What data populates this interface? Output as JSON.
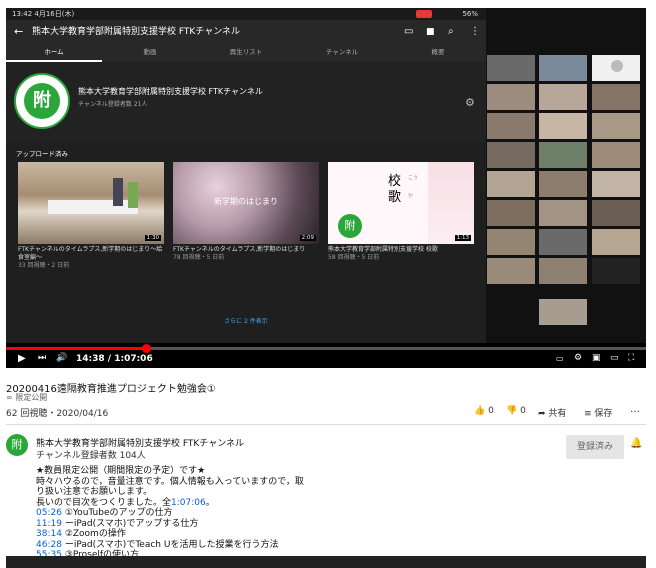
{
  "phone": {
    "status_time": "13:42 4月16日(木)",
    "status_right": "56%",
    "app_title": "熊本大学教育学部附属特別支援学校 FTKチャンネル",
    "tabs": [
      "ホーム",
      "動画",
      "再生リスト",
      "チャンネル",
      "概要"
    ],
    "channel_name": "熊本大学教育学部附属特別支援学校 FTKチャンネル",
    "channel_subs": "チャンネル登録者数 21人",
    "logo_char": "附",
    "uploads_title": "アップロード済み",
    "videos": [
      {
        "title": "FTKチャンネルのタイムラプス,新学期のはじまり〜給食室編〜",
        "views": "33 回視聴・2 日前",
        "duration": "1:30",
        "thumb_text": ""
      },
      {
        "title": "FTKチャンネルのタイムラプス,新学期のはじまり",
        "views": "78 回視聴・5 日前",
        "duration": "2:09",
        "thumb_text": "新学期のはじまり"
      },
      {
        "title": "熊本大学教育学部附属特別支援学校 校歌",
        "views": "58 回視聴・5 日前",
        "duration": "1:13",
        "thumb_text": "校歌"
      }
    ],
    "more_link": "さらに 2 件表示",
    "kana1": "こう",
    "kana2": "か"
  },
  "player": {
    "time": "14:38 / 1:07:06",
    "progress": 0.218
  },
  "video": {
    "title": "20200416遠隔教育推進プロジェクト勉強会①",
    "visibility": "限定公開",
    "meta": "62 回視聴・2020/04/16",
    "likes": "0",
    "dislikes": "0",
    "share": "共有",
    "save": "保存",
    "more": "…"
  },
  "channel": {
    "name": "熊本大学教育学部附属特別支援学校 FTKチャンネル",
    "subs": "チャンネル登録者数 104人",
    "subscribe_label": "登録済み"
  },
  "description": {
    "line1": "★教員限定公開（期間限定の予定）です★",
    "line2": "時々ハウるので，音量注意です。個人情報も入っていますので，取",
    "line3": "り扱い注意でお願いします。",
    "line4_prefix": "長いので目次をつくりました。全",
    "line4_link": "1:07:06",
    "line4_suffix": "。",
    "chapters": [
      {
        "time": "05:26",
        "text": "①YouTubeのアップの仕方"
      },
      {
        "time": "11:19",
        "text": "ーiPad(スマホ)でアップする仕方"
      },
      {
        "time": "38:14",
        "text": "②Zoomの操作"
      },
      {
        "time": "46:28",
        "text": "ーiPad(スマホ)でTeach Uを活用した授業を行う方法"
      },
      {
        "time": "55:35",
        "text": "③Proselfの使い方"
      }
    ]
  },
  "colors": {
    "accent_red": "#ff0000",
    "link_blue": "#065fd4",
    "logo_green": "#2aa63a"
  }
}
